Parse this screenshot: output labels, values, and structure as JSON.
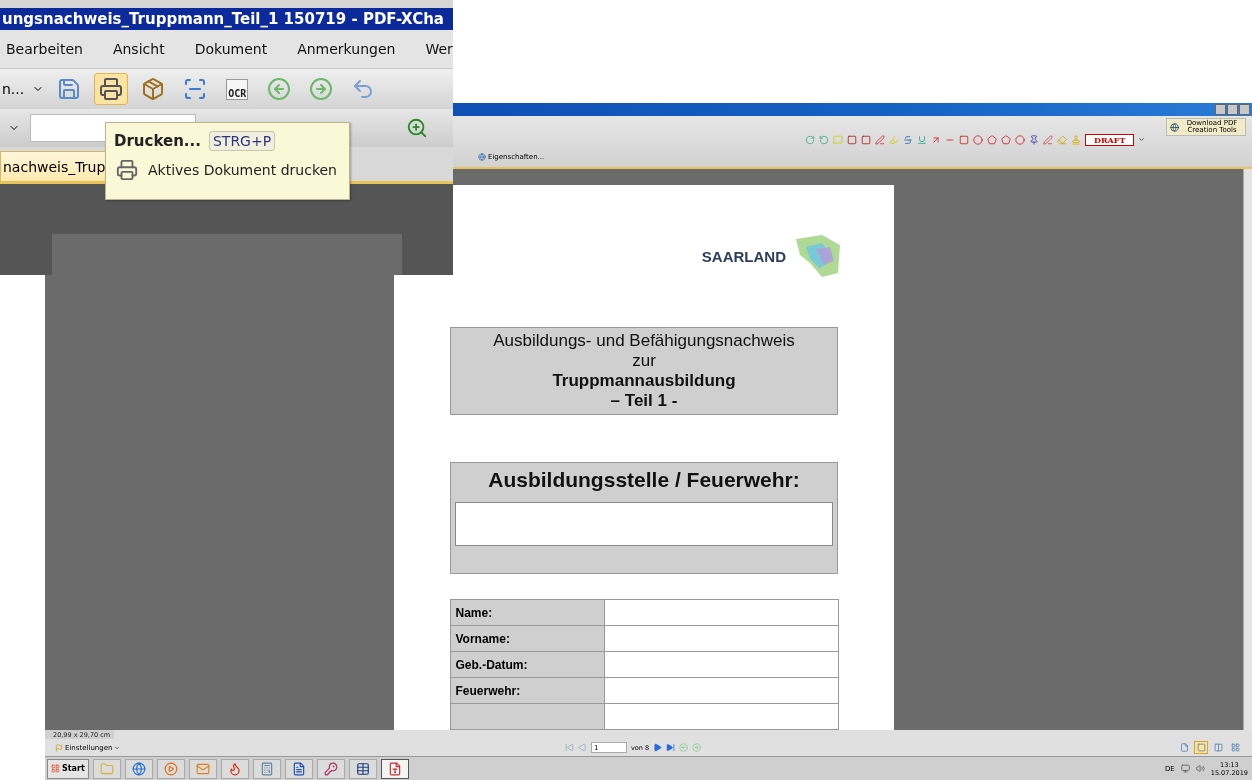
{
  "inset_window": {
    "title": "ungsnachweis_Truppmann_Teil_1 150719 - PDF-XCha",
    "menu": [
      "Bearbeiten",
      "Ansicht",
      "Dokument",
      "Anmerkungen",
      "Wer"
    ],
    "toolbar_dropdown": "n...",
    "toolbar": [
      {
        "kind": "save",
        "selected": false
      },
      {
        "kind": "print",
        "selected": true
      },
      {
        "kind": "export",
        "selected": false
      },
      {
        "kind": "scan",
        "selected": false
      },
      {
        "kind": "ocr",
        "selected": false
      },
      {
        "kind": "back",
        "selected": false
      },
      {
        "kind": "forward",
        "selected": false
      },
      {
        "kind": "undo",
        "selected": false
      }
    ],
    "ocr_label": "OCR",
    "document_tab": "nachweis_Trup",
    "tooltip": {
      "title": "Drucken...",
      "shortcut": "STRG+P",
      "description": "Aktives Dokument drucken"
    }
  },
  "main_window": {
    "download_button": "Download PDF Creation Tools",
    "stamp_label": "DRAFT",
    "properties_button": "Eigenschaften..."
  },
  "document": {
    "logo_text": "SAARLAND",
    "title_lines": [
      {
        "text": "Ausbildungs- und Befähigungsnachweis",
        "bold": false
      },
      {
        "text": "zur",
        "bold": false
      },
      {
        "text": "Truppmannausbildung",
        "bold": true
      },
      {
        "text": "– Teil 1 -",
        "bold": true
      }
    ],
    "station_heading": "Ausbildungsstelle / Feuerwehr:",
    "form_rows": [
      {
        "label": "Name:"
      },
      {
        "label": "Vorname:"
      },
      {
        "label": "Geb.-Datum:"
      },
      {
        "label": "Feuerwehr:"
      },
      {
        "label": ""
      }
    ]
  },
  "status_bar": {
    "page_size": "20,99 x 29,70 cm",
    "settings": "Einstellungen",
    "page_input": "1",
    "page_count": "von 8",
    "view_buttons": [
      {
        "kind": "single",
        "selected": false
      },
      {
        "kind": "continuous",
        "selected": true
      },
      {
        "kind": "facing",
        "selected": false
      },
      {
        "kind": "grid",
        "selected": false
      }
    ]
  },
  "taskbar": {
    "start": "Start",
    "apps": [
      {
        "kind": "folder",
        "selected": false
      },
      {
        "kind": "browser",
        "selected": false
      },
      {
        "kind": "media",
        "selected": false
      },
      {
        "kind": "mail",
        "selected": false
      },
      {
        "kind": "flame",
        "selected": false
      },
      {
        "kind": "calculator",
        "selected": false
      },
      {
        "kind": "word",
        "selected": false
      },
      {
        "kind": "key",
        "selected": false
      },
      {
        "kind": "table",
        "selected": false
      },
      {
        "kind": "pdf",
        "selected": true
      }
    ],
    "language": "DE",
    "time": "13:13",
    "date": "15.07.2019"
  }
}
